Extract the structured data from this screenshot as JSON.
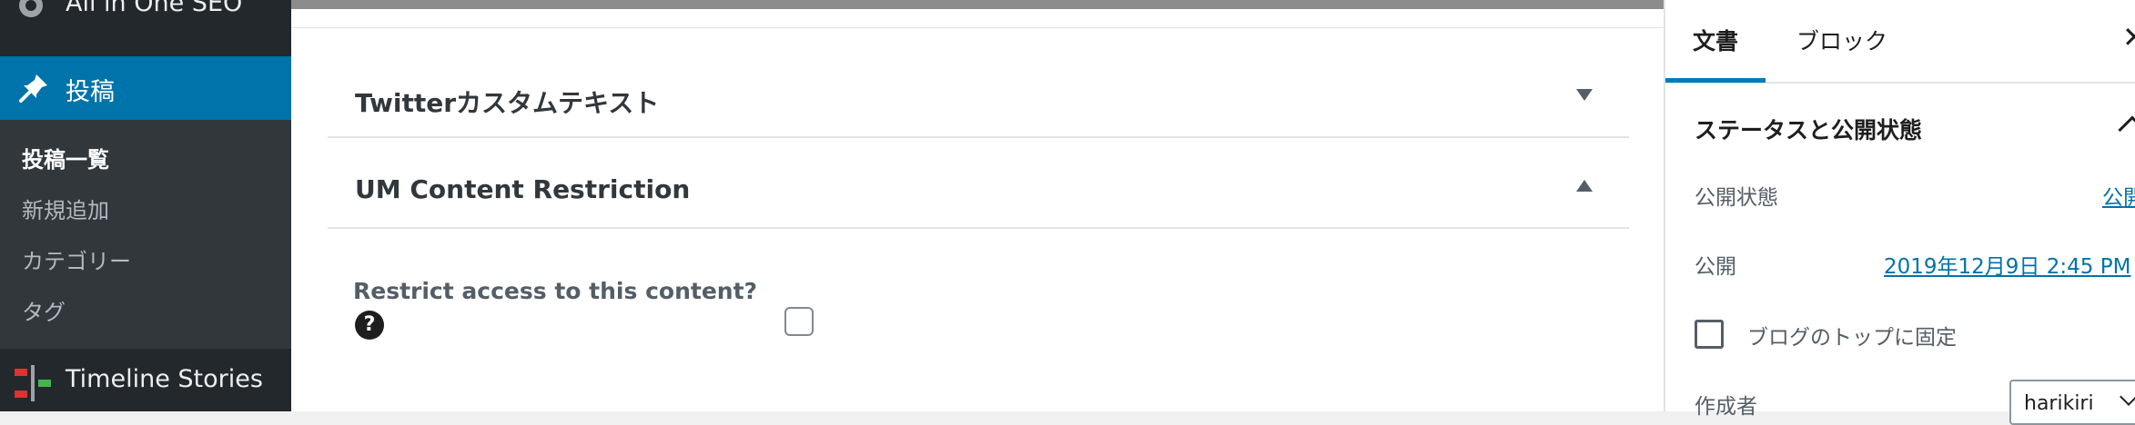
{
  "admin_menu": {
    "aio_label": "All in One SEO",
    "posts_label": "投稿",
    "submenu": [
      {
        "label": "投稿一覧"
      },
      {
        "label": "新規追加"
      },
      {
        "label": "カテゴリー"
      },
      {
        "label": "タグ"
      }
    ],
    "timeline_label": "Timeline Stories"
  },
  "main": {
    "panels": [
      {
        "title": "Twitterカスタムテキスト",
        "state": "collapsed"
      },
      {
        "title": "UM Content Restriction",
        "state": "expanded"
      }
    ],
    "restrict_label": "Restrict access to this content?",
    "help_glyph": "?"
  },
  "settings": {
    "tabs": [
      "文書",
      "ブロック"
    ],
    "close_glyph": "✕",
    "section_title": "ステータスと公開状態",
    "visibility_label": "公開状態",
    "visibility_value": "公開",
    "publish_label": "公開",
    "publish_value": "2019年12月9日 2:45 PM",
    "sticky_label": "ブログのトップに固定",
    "author_label": "作成者",
    "author_value": "harikiri"
  },
  "colors": {
    "admin_bg": "#23282d",
    "submenu_bg": "#32373c",
    "accent": "#0073aa",
    "tab_accent": "#007cba"
  }
}
